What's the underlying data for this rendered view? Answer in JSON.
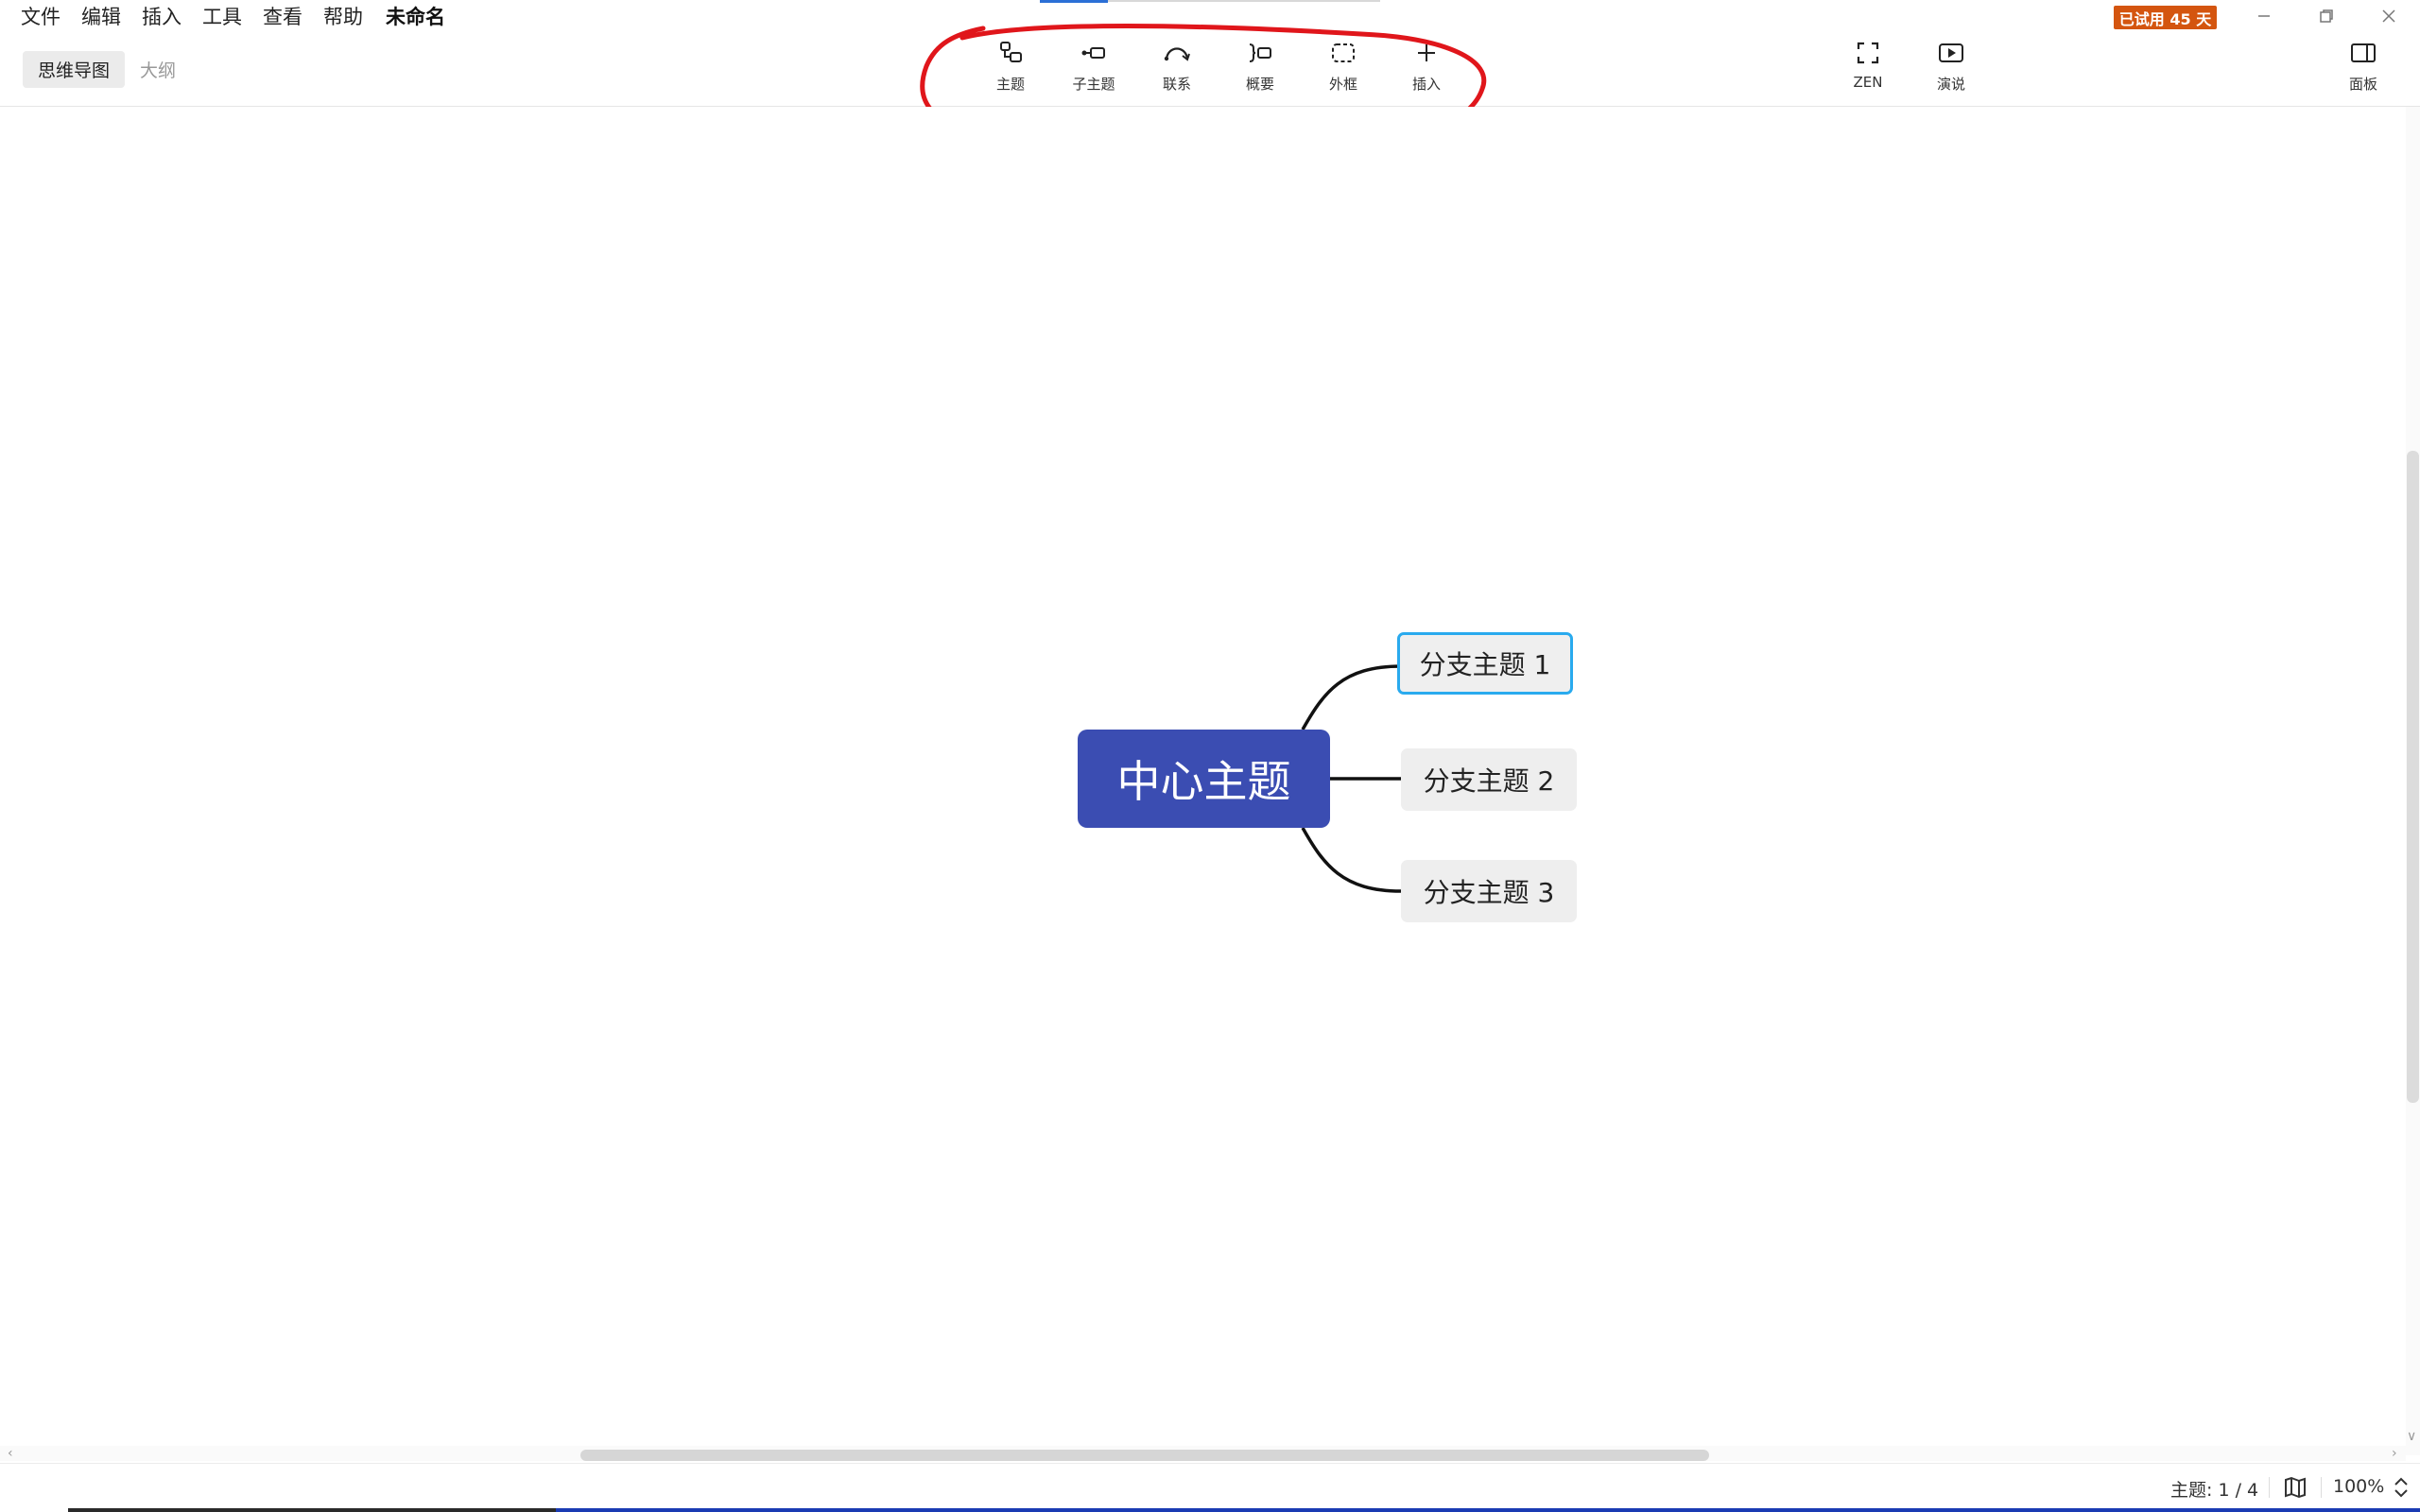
{
  "menu": {
    "file": "文件",
    "edit": "编辑",
    "insert": "插入",
    "tools": "工具",
    "view": "查看",
    "help": "帮助",
    "document_title": "未命名"
  },
  "view_switch": {
    "mindmap": "思维导图",
    "outline": "大纲",
    "active": "mindmap"
  },
  "toolbar": {
    "topic": "主题",
    "subtopic": "子主题",
    "relationship": "联系",
    "summary": "概要",
    "boundary": "外框",
    "insert": "插入"
  },
  "right_tools": {
    "zen": "ZEN",
    "present": "演说",
    "panel": "面板"
  },
  "trial_badge": "已试用 45 天",
  "mindmap": {
    "central_topic": "中心主题",
    "branches": [
      {
        "label": "分支主题 1",
        "selected": true
      },
      {
        "label": "分支主题 2",
        "selected": false
      },
      {
        "label": "分支主题 3",
        "selected": false
      }
    ]
  },
  "status": {
    "topic_count": "主题: 1 / 4",
    "zoom": "100%"
  },
  "colors": {
    "central_fill": "#3b4db2",
    "branch_fill": "#eeeeee",
    "selection_border": "#29aaee",
    "trial_badge": "#d4550f",
    "annotation": "#e0161b"
  }
}
